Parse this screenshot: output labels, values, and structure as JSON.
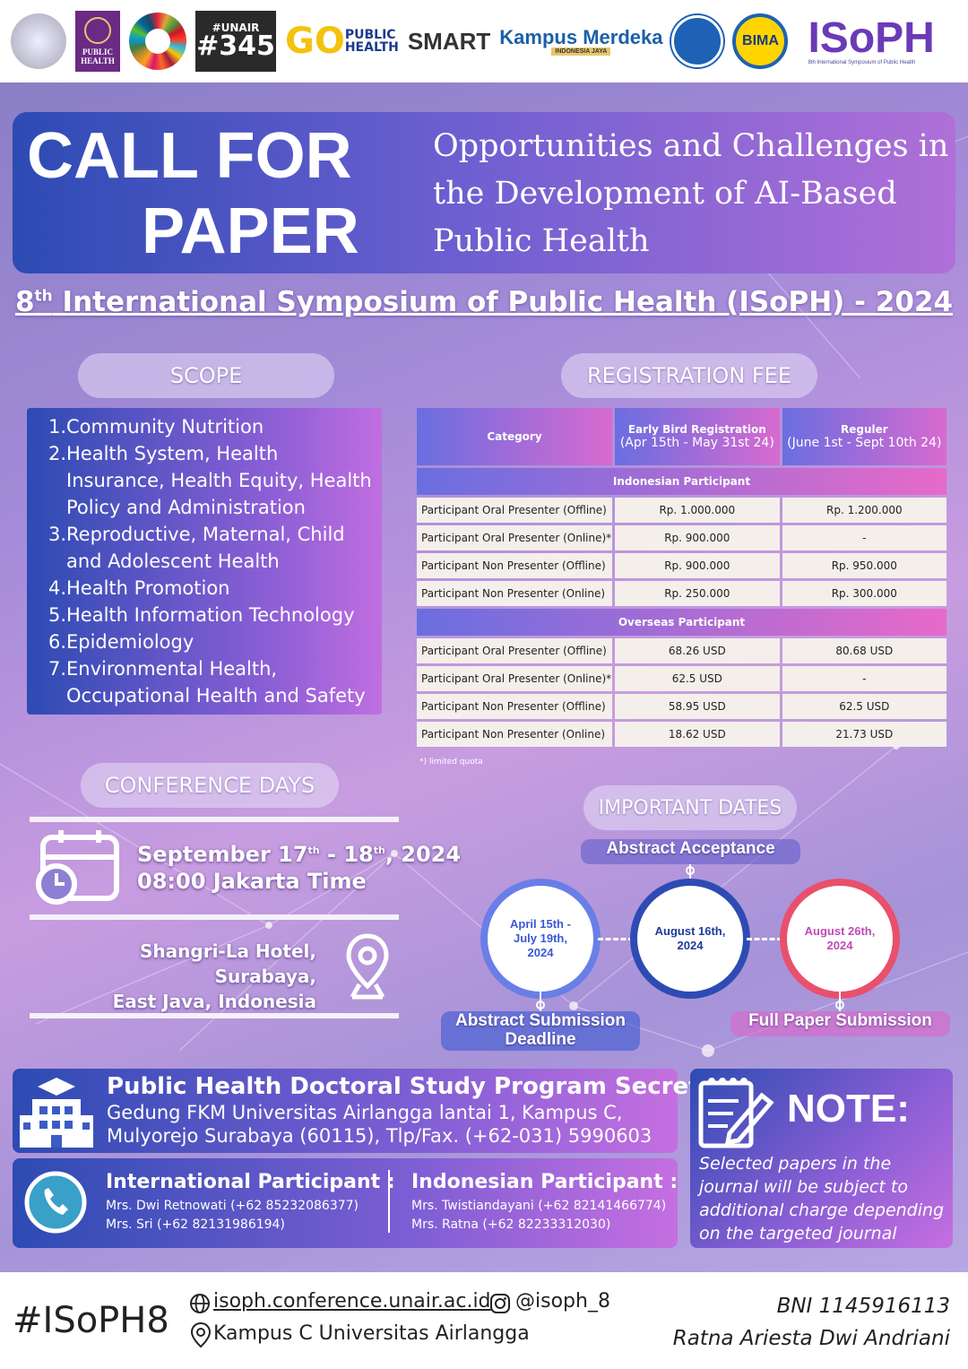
{
  "logos": {
    "public_health": "PUBLIC HEALTH",
    "unair_number": "#345",
    "unair_tag": "#UNAIR",
    "go_public_health": "GO",
    "go_sub": "PUBLIC HEALTH",
    "smart": "SMART",
    "kampus_merdeka": "Kampus Merdeka",
    "kampus_merdeka_sub": "INDONESIA JAYA",
    "bima": "BIMA",
    "isoph": "ISoPH",
    "isoph_sub": "8th International Symposium of Public Health"
  },
  "header": {
    "cfp_line1": "CALL FOR",
    "cfp_line2": "PAPER",
    "theme": "Opportunities and Challenges in the Development of AI-Based Public Health",
    "symposium_num": "8",
    "symposium_sup": "th",
    "symposium_rest": " International Symposium of Public Health (ISoPH) - 2024"
  },
  "scope": {
    "title": "SCOPE",
    "items": [
      {
        "num": "1.",
        "text": "Community Nutrition"
      },
      {
        "num": "2.",
        "text": "Health System, Health Insurance, Health Equity, Health Policy and Administration"
      },
      {
        "num": "3.",
        "text": "Reproductive, Maternal, Child and Adolescent Health"
      },
      {
        "num": "4.",
        "text": "Health Promotion"
      },
      {
        "num": "5.",
        "text": "Health Information Technology"
      },
      {
        "num": "6.",
        "text": "Epidemiology"
      },
      {
        "num": "7.",
        "text": "Environmental Health, Occupational Health and Safety"
      }
    ]
  },
  "fee": {
    "title": "REGISTRATION FEE",
    "col_category": "Category",
    "col_early": "Early Bird Registration",
    "col_early_sub": "(Apr 15th - May 31st 24)",
    "col_regular": "Reguler",
    "col_regular_sub": "(June 1st - Sept 10th 24)",
    "indonesian_label": "Indonesian Participant",
    "overseas_label": "Overseas Participant",
    "indonesian": [
      {
        "cat": "Participant Oral Presenter (Offline)",
        "early": "Rp.  1.000.000",
        "regular": "Rp. 1.200.000"
      },
      {
        "cat": "Participant Oral Presenter (Online)*",
        "early": "Rp.    900.000",
        "regular": "-"
      },
      {
        "cat": "Participant Non Presenter (Offline)",
        "early": "Rp.    900.000",
        "regular": "Rp.    950.000"
      },
      {
        "cat": "Participant Non Presenter (Online)",
        "early": "Rp.    250.000",
        "regular": "Rp.    300.000"
      }
    ],
    "overseas": [
      {
        "cat": "Participant Oral Presenter (Offline)",
        "early": "68.26 USD",
        "regular": "80.68 USD"
      },
      {
        "cat": "Participant Oral Presenter (Online)*",
        "early": "62.5   USD",
        "regular": "-"
      },
      {
        "cat": "Participant Non Presenter (Offline)",
        "early": "58.95 USD",
        "regular": "62.5   USD"
      },
      {
        "cat": "Participant Non Presenter (Online)",
        "early": "18.62   USD",
        "regular": "21.73  USD"
      }
    ],
    "footnote": "*) limited quota"
  },
  "conference": {
    "title": "CONFERENCE DAYS",
    "date_a": "September 17",
    "date_a_sup": "th",
    "date_b": " - 18",
    "date_b_sup": "th",
    "date_c": ", 2024",
    "time": "08:00 Jakarta Time",
    "venue_line1": "Shangri-La Hotel, Surabaya,",
    "venue_line2": "East Java, Indonesia"
  },
  "dates": {
    "title": "IMPORTANT DATES",
    "abstract_acceptance": "Abstract Acceptance",
    "abstract_deadline": "Abstract Submission Deadline",
    "full_paper": "Full Paper Submission",
    "date1": "April 15th - July 19th, 2024",
    "date2": "August 16th, 2024",
    "date3": "August 26th, 2024"
  },
  "secretariat": {
    "title": "Public Health Doctoral Study Program Secretariat",
    "line1": "Gedung FKM Universitas Airlangga lantai 1, Kampus C,",
    "line2": "Mulyorejo Surabaya (60115), Tlp/Fax. (+62-031) 5990603"
  },
  "contacts": {
    "intl_title": "International Participant :",
    "intl_1": "Mrs. Dwi Retnowati (+62 85232086377)",
    "intl_2": "Mrs. Sri (+62 82131986194)",
    "indo_title": "Indonesian Participant :",
    "indo_1": "Mrs. Twistiandayani (+62 82141466774)",
    "indo_2": "Mrs. Ratna (+62 82233312030)"
  },
  "note": {
    "title": "NOTE:",
    "text": "Selected papers in the journal will be subject to additional charge depending on the targeted journal"
  },
  "footer": {
    "hashtag": "#ISoPH8",
    "website": "isoph.conference.unair.ac.id",
    "instagram": "@isoph_8",
    "campus": "Kampus C Universitas Airlangga",
    "bank": "BNI 1145916113",
    "account_name": "Ratna Ariesta Dwi Andriani"
  },
  "colors": {
    "primary_blue": "#2d4bb3",
    "purple": "#8e5fd6",
    "pink": "#e76ac9",
    "background": "#a58bd9"
  }
}
